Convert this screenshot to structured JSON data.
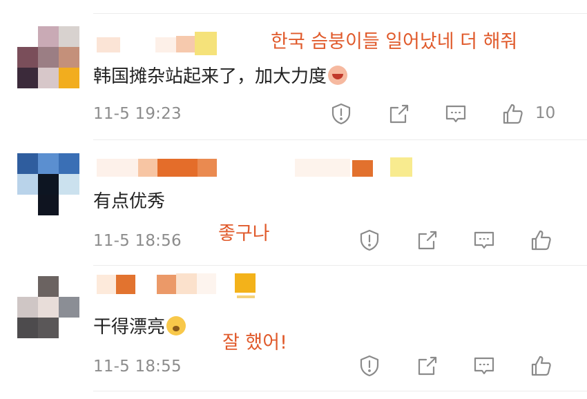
{
  "comments": [
    {
      "content": "韩国摊杂站起来了，加大力度",
      "time": "11-5 19:23",
      "likes": "10",
      "annotation": "한국 슴붕이들 일어났네 더 해줘",
      "emoji": "laugh-emoji"
    },
    {
      "content": "有点优秀",
      "time": "11-5 18:56",
      "likes": "",
      "annotation": "좋구나",
      "emoji": ""
    },
    {
      "content": "干得漂亮",
      "time": "11-5 18:55",
      "likes": "",
      "annotation": "잘 했어!",
      "emoji": "wow-emoji"
    }
  ],
  "icons": {
    "report": "shield-exclamation-icon",
    "repost": "share-arrow-icon",
    "reply": "comment-bubble-icon",
    "like": "thumbs-up-icon"
  },
  "colors": {
    "annotation": "#e05a2b",
    "meta_text": "#8c8c8c",
    "icon": "#8a8a8a"
  }
}
